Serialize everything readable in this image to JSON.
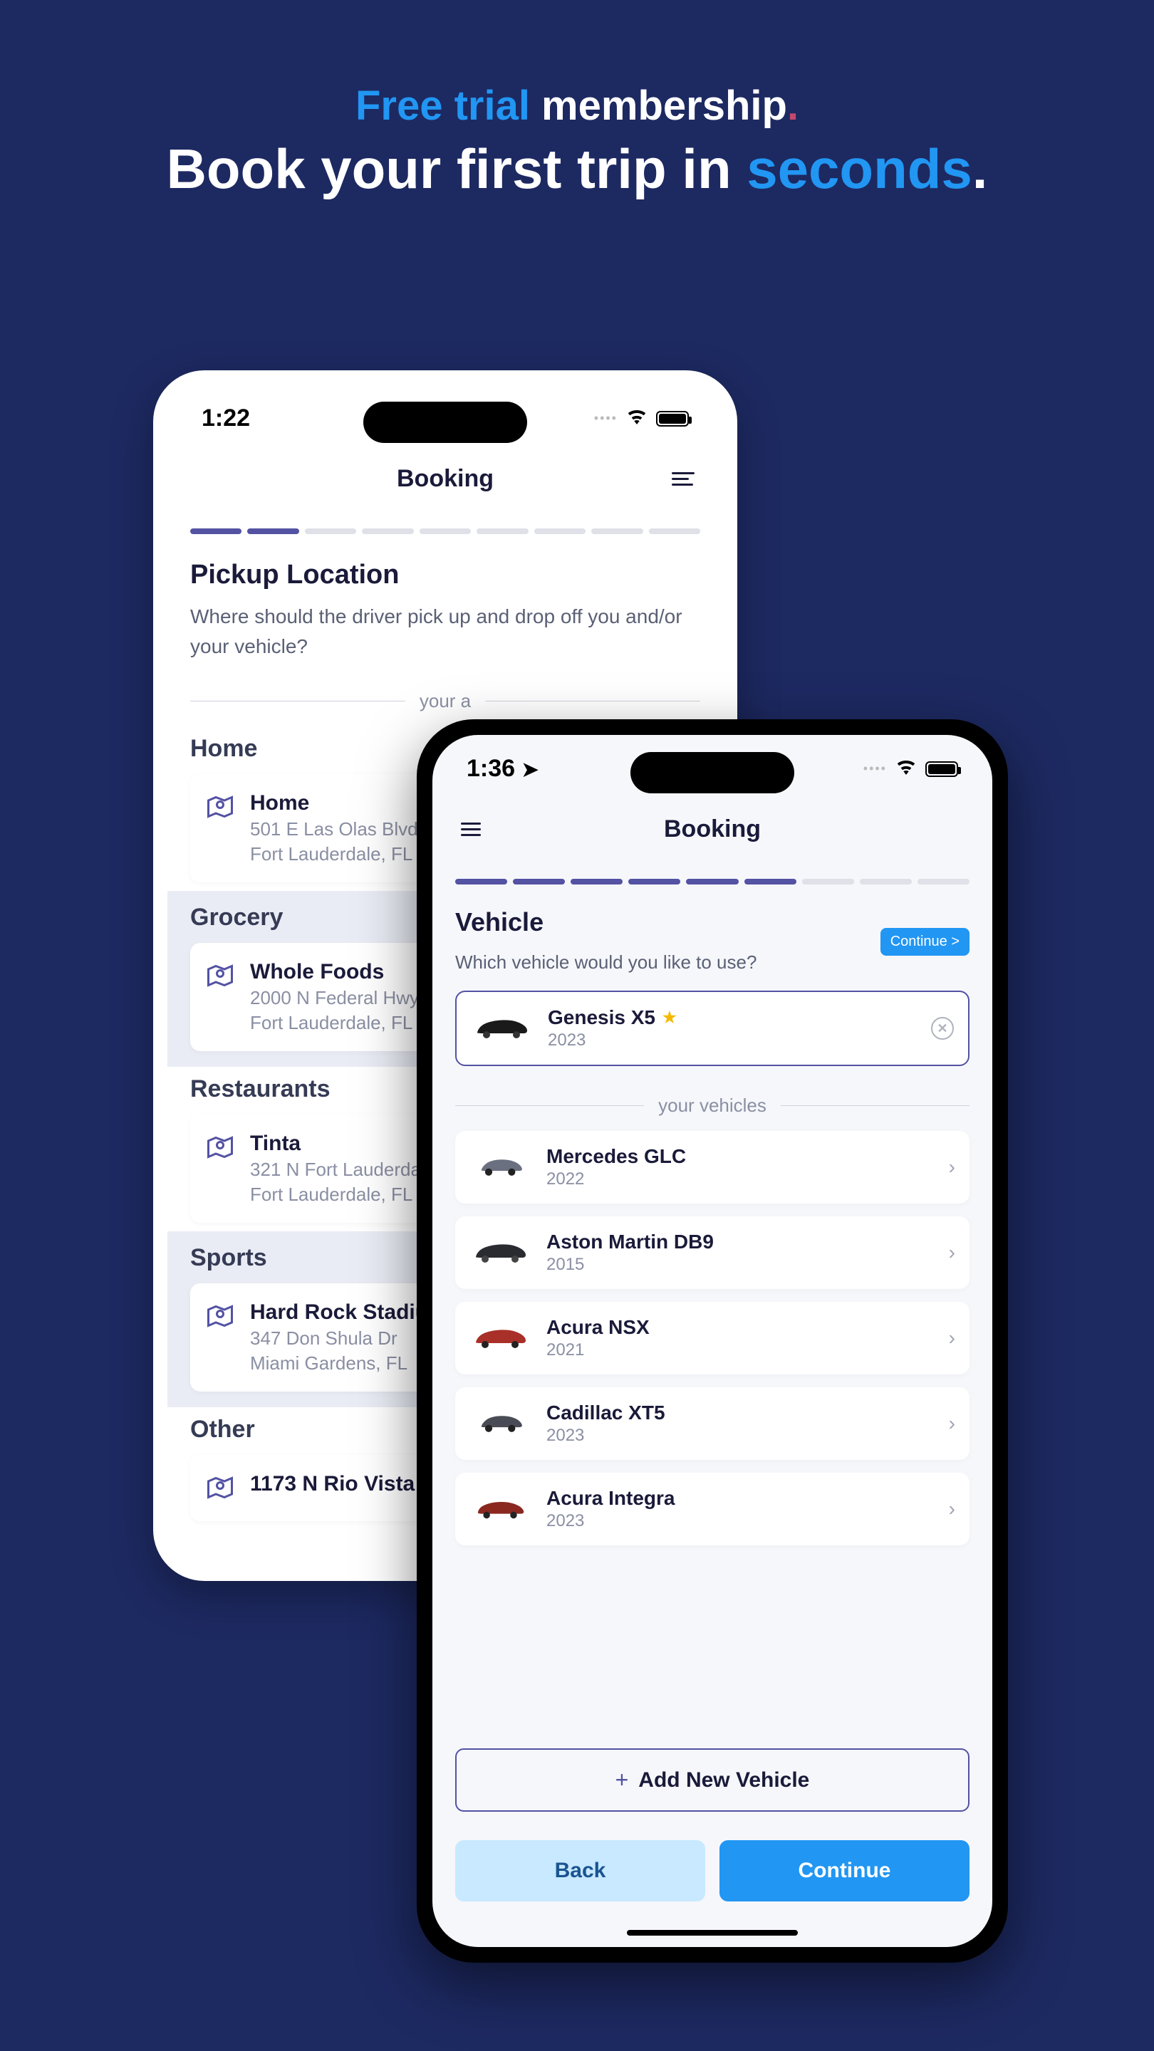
{
  "hero": {
    "line1_cyan": "Free trial",
    "line1_white": " membership",
    "line1_period": ".",
    "line2_prefix": "Book your first trip in ",
    "line2_blue": "seconds",
    "line2_period": "."
  },
  "phone1": {
    "time": "1:22",
    "title": "Booking",
    "section_title": "Pickup Location",
    "section_sub": "Where should the driver pick up and drop off you and/or your vehicle?",
    "divider": "your a",
    "categories": [
      {
        "title": "Home",
        "name": "Home",
        "addr1": "501 E Las Olas Blvd",
        "addr2": "Fort Lauderdale, FL"
      },
      {
        "title": "Grocery",
        "name": "Whole Foods",
        "addr1": "2000 N Federal Hwy",
        "addr2": "Fort Lauderdale, FL"
      },
      {
        "title": "Restaurants",
        "name": "Tinta",
        "addr1": "321 N Fort Lauderda",
        "addr2": "Fort Lauderdale, FL"
      },
      {
        "title": "Sports",
        "name": "Hard Rock Stadiu",
        "addr1": "347 Don Shula Dr",
        "addr2": "Miami Gardens, FL"
      },
      {
        "title": "Other",
        "name": "1173 N Rio Vista",
        "addr1": "",
        "addr2": ""
      }
    ]
  },
  "phone2": {
    "time": "1:36",
    "title": "Booking",
    "section_title": "Vehicle",
    "section_sub": "Which vehicle would you like to use?",
    "continue_badge": "Continue >",
    "selected": {
      "name": "Genesis X5",
      "year": "2023"
    },
    "divider": "your vehicles",
    "vehicles": [
      {
        "name": "Mercedes GLC",
        "year": "2022",
        "color": "#6a7080"
      },
      {
        "name": "Aston Martin DB9",
        "year": "2015",
        "color": "#2a2b30"
      },
      {
        "name": "Acura NSX",
        "year": "2021",
        "color": "#a83028"
      },
      {
        "name": "Cadillac XT5",
        "year": "2023",
        "color": "#4a4c55"
      },
      {
        "name": "Acura Integra",
        "year": "2023",
        "color": "#8a2820"
      }
    ],
    "add_label": "Add New Vehicle",
    "back_label": "Back",
    "continue_label": "Continue"
  }
}
